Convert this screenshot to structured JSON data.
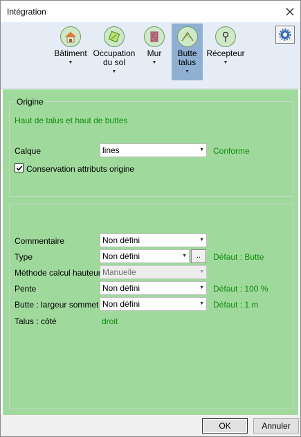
{
  "window": {
    "title": "Intégration"
  },
  "ribbon": {
    "buttons": [
      {
        "line1": "Bâtiment",
        "line2": ""
      },
      {
        "line1": "Occupation",
        "line2": "du sol"
      },
      {
        "line1": "Mur",
        "line2": ""
      },
      {
        "line1": "Butte",
        "line2": "talus"
      },
      {
        "line1": "Récepteur",
        "line2": ""
      }
    ],
    "active_index": 3
  },
  "origin": {
    "legend": "Origine",
    "subtitle": "Haut de talus et haut de buttes",
    "calque_label": "Calque",
    "calque_value": "lines",
    "calque_status": "Conforme",
    "conservation_label": "Conservation attributs origine",
    "conservation_checked": true
  },
  "attributes": {
    "commentaire": {
      "label": "Commentaire",
      "value": "Non défini"
    },
    "type": {
      "label": "Type",
      "value": "Non défini",
      "browse": "..",
      "default": "Défaut : Butte"
    },
    "methode": {
      "label": "Méthode calcul hauteur",
      "value": "Manuelle"
    },
    "pente": {
      "label": "Pente",
      "value": "Non défini",
      "default": "Défaut : 100 %"
    },
    "largeur": {
      "label": "Butte : largeur sommet",
      "value": "Non défini",
      "default": "Défaut : 1 m"
    },
    "cote": {
      "label": "Talus : côté",
      "value": "droit"
    }
  },
  "footer": {
    "ok": "OK",
    "cancel": "Annuler"
  },
  "colors": {
    "panel": "#9fda9c",
    "accent_text": "#0f8a0f",
    "ribbon_active": "#8fb0d2"
  }
}
